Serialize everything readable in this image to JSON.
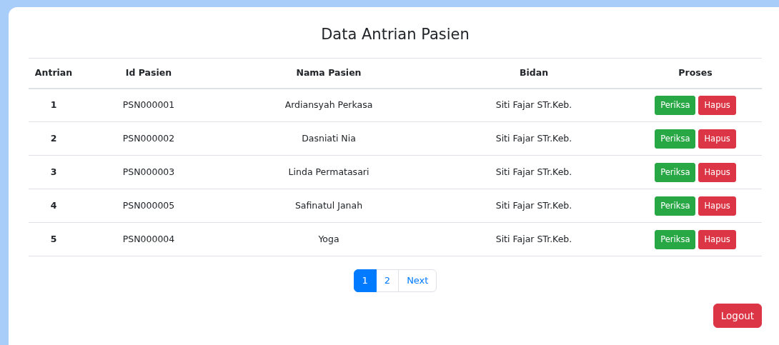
{
  "title": "Data Antrian Pasien",
  "table": {
    "columns": [
      "Antrian",
      "Id Pasien",
      "Nama Pasien",
      "Bidan",
      "Proses"
    ],
    "rows": [
      {
        "antrian": "1",
        "id": "PSN000001",
        "nama": "Ardiansyah Perkasa",
        "bidan": "Siti Fajar STr.Keb.",
        "actions": [
          "Periksa",
          "Hapus"
        ]
      },
      {
        "antrian": "2",
        "id": "PSN000002",
        "nama": "Dasniati Nia",
        "bidan": "Siti Fajar STr.Keb.",
        "actions": [
          "Periksa",
          "Hapus"
        ]
      },
      {
        "antrian": "3",
        "id": "PSN000003",
        "nama": "Linda Permatasari",
        "bidan": "Siti Fajar STr.Keb.",
        "actions": [
          "Periksa",
          "Hapus"
        ]
      },
      {
        "antrian": "4",
        "id": "PSN000005",
        "nama": "Safinatul Janah",
        "bidan": "Siti Fajar STr.Keb.",
        "actions": [
          "Periksa",
          "Hapus"
        ]
      },
      {
        "antrian": "5",
        "id": "PSN000004",
        "nama": "Yoga",
        "bidan": "Siti Fajar STr.Keb.",
        "actions": [
          "Periksa",
          "Hapus"
        ]
      }
    ]
  },
  "pagination": [
    {
      "label": "1",
      "selected": true
    },
    {
      "label": "2",
      "selected": false
    },
    {
      "label": "Next",
      "selected": false
    }
  ],
  "logout": "Logout"
}
